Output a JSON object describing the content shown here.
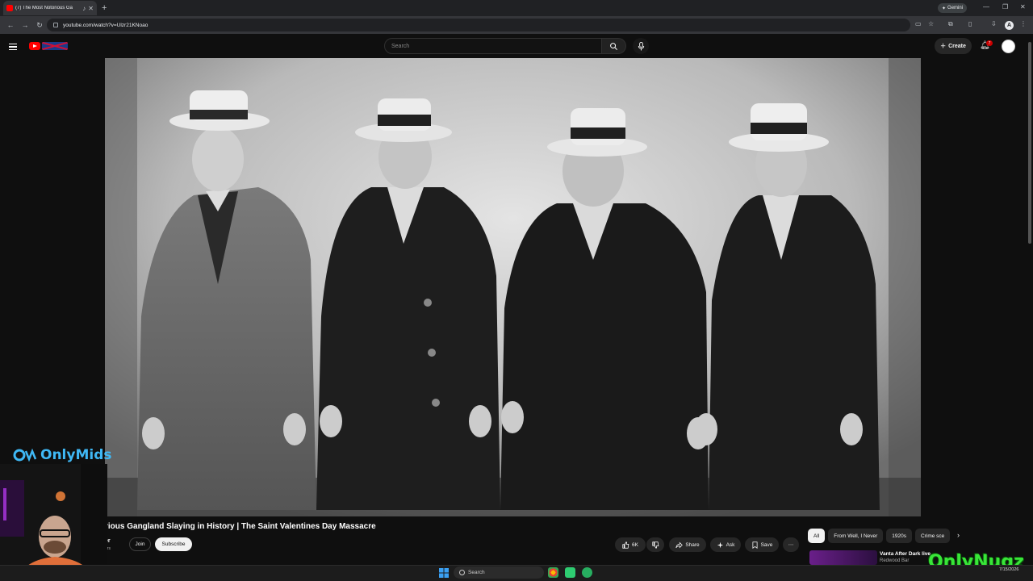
{
  "browser": {
    "tab_title": "(7) The Most Notorious Ga",
    "url": "youtube.com/watch?v=Ulzr21KNoao",
    "gemini_label": "Gemini",
    "profile_initial": "A"
  },
  "youtube": {
    "search_placeholder": "Search",
    "create_label": "Create",
    "notification_count": "7"
  },
  "video": {
    "title": "rious Gangland Slaying in History | The Saint Valentines Day Massacre",
    "channel_name": "er",
    "channel_sub": "ers",
    "join_label": "Join",
    "subscribe_label": "Subscribe",
    "actions": {
      "likes": "6K",
      "share": "Share",
      "ask": "Ask",
      "save": "Save"
    }
  },
  "chips": [
    "All",
    "From Well, I Never",
    "1920s",
    "Crime sce"
  ],
  "recommendation": {
    "title": "Vanta After Dark live",
    "subtitle": "Redwood Bar"
  },
  "overlay": {
    "left_logo": "OnlyMids",
    "right_logo": "OnlyNugz"
  },
  "taskbar": {
    "search_label": "Search",
    "date": "7/15/2026"
  },
  "colors": {
    "youtube_red": "#ff0000",
    "background": "#0f0f0f",
    "onlymids_blue": "#3fb8f5",
    "onlynugz_green": "#39e639"
  }
}
